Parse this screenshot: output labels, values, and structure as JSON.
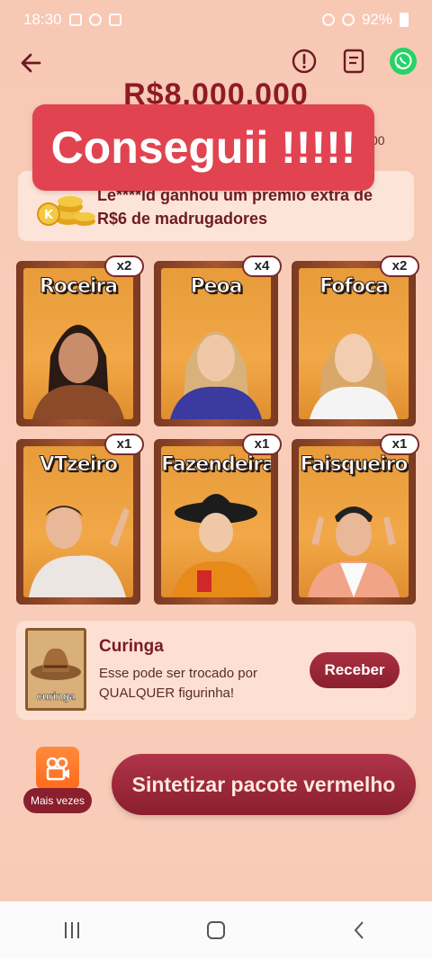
{
  "status_bar": {
    "time": "18:30",
    "battery": "92%"
  },
  "header": {
    "prize_amount": "R$8.000.000",
    "prize_suffix": "00"
  },
  "banner": {
    "text": "Conseguii !!!!!"
  },
  "notice": {
    "text": "Le****ld ganhou um prêmio extra de R$6 de madrugadores"
  },
  "cards": [
    {
      "name": "Roceira",
      "count": "x2"
    },
    {
      "name": "Peoa",
      "count": "x4"
    },
    {
      "name": "Fofoca",
      "count": "x2"
    },
    {
      "name": "VTzeiro",
      "count": "x1"
    },
    {
      "name": "Fazendeira",
      "count": "x1"
    },
    {
      "name": "Faisqueiro",
      "count": "x1"
    }
  ],
  "curinga": {
    "card_label": "curinga",
    "title": "Curinga",
    "description": "Esse pode ser trocado por QUALQUER figurinha!",
    "button_label": "Receber"
  },
  "actions": {
    "more_label": "Mais vezes",
    "synthesize_label": "Sintetizar pacote vermelho"
  },
  "colors": {
    "accent": "#8a1f2d",
    "banner": "#e24350",
    "whatsapp": "#25d366"
  },
  "icons": [
    "back-arrow-icon",
    "info-icon",
    "document-icon",
    "whatsapp-icon",
    "video-icon"
  ]
}
